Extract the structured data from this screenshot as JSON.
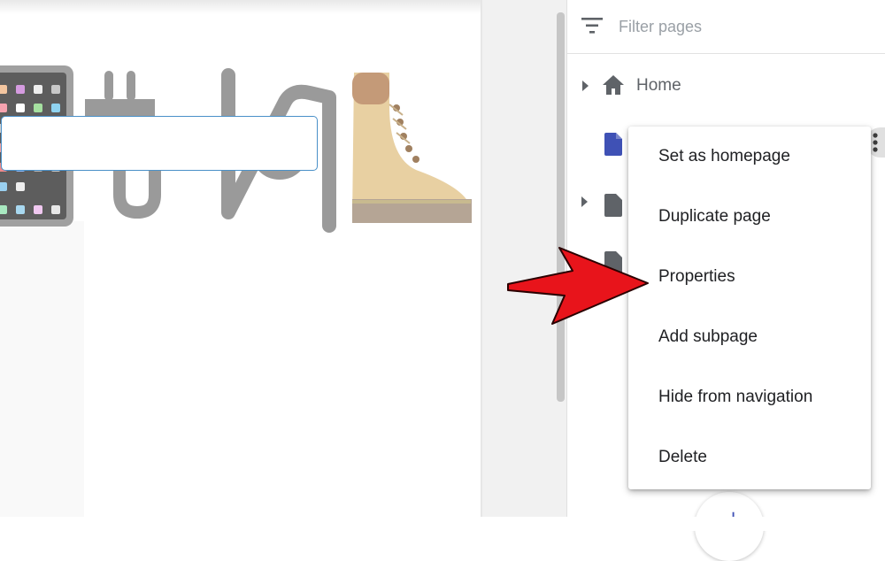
{
  "panel": {
    "filter": {
      "placeholder": "Filter pages",
      "value": ""
    },
    "pages": [
      {
        "label": "Home",
        "icon": "home-icon",
        "expandable": true
      },
      {
        "label": "",
        "icon": "page-icon",
        "selected": true,
        "expandable": false
      },
      {
        "label": "",
        "icon": "page-icon",
        "expandable": true
      },
      {
        "label": "",
        "icon": "page-icon",
        "expandable": false
      }
    ]
  },
  "context_menu": {
    "items": [
      "Set as homepage",
      "Duplicate page",
      "Properties",
      "Add subpage",
      "Hide from navigation",
      "Delete"
    ]
  },
  "annotation": {
    "arrow_color": "#e8141b",
    "points_to": "Properties"
  },
  "colors": {
    "accent": "#3f51b5",
    "selected_border": "#4a90c8",
    "icon_gray": "#5f6368"
  },
  "canvas": {
    "emoji_images": [
      "tablet-icon",
      "electric-plug-icon",
      "pin-icon",
      "boot-icon"
    ]
  }
}
